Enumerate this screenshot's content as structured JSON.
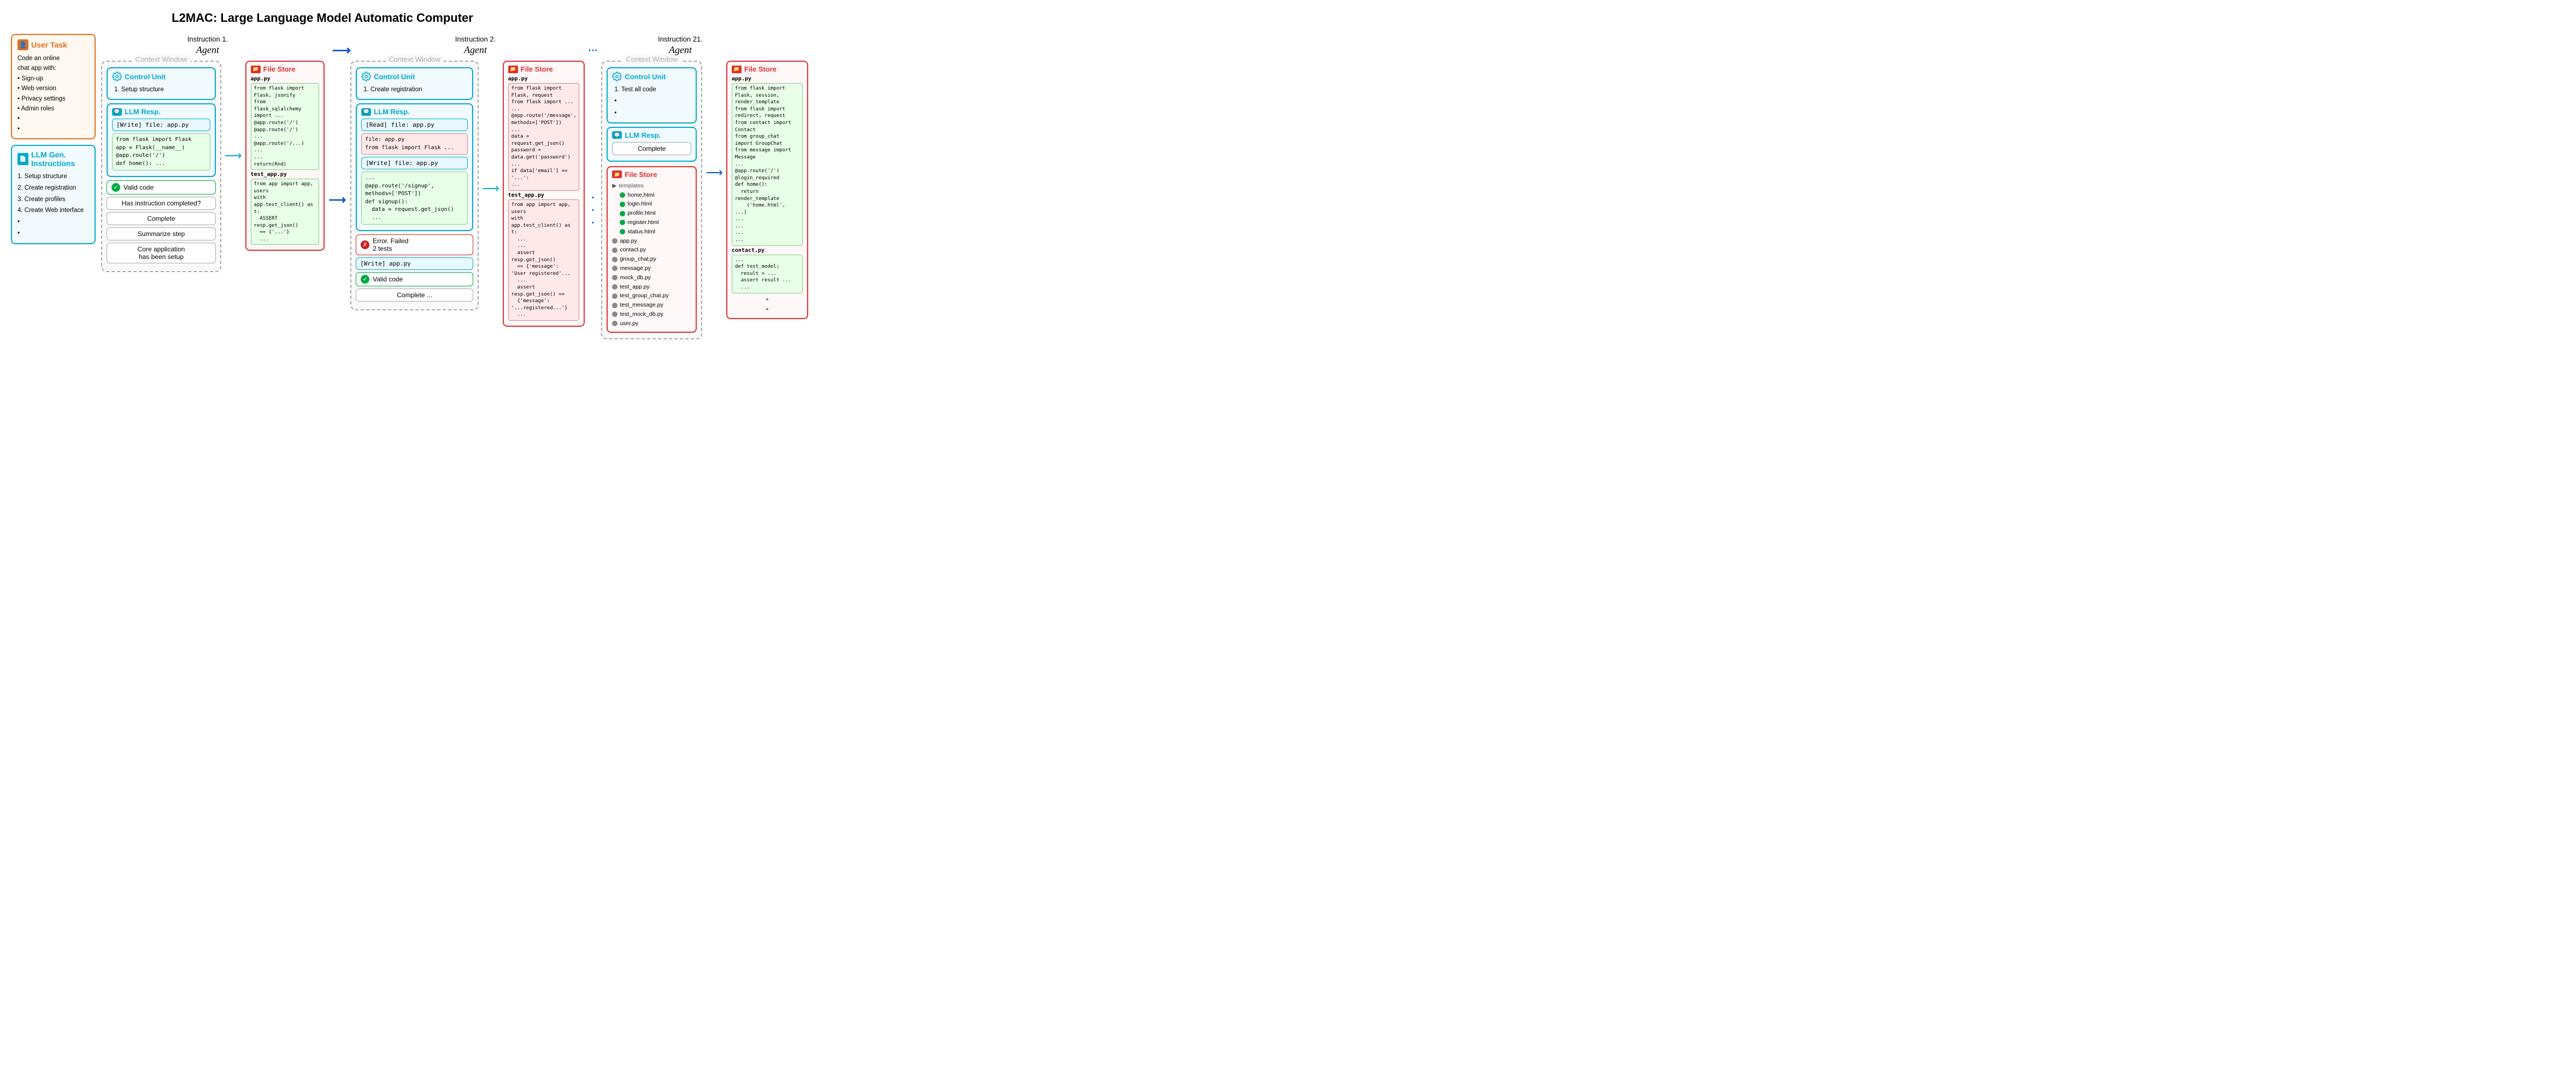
{
  "title": "L2MAC: Large Language Model Automatic Computer",
  "left_panel": {
    "user_task": {
      "header": "User Task",
      "content": "Code an online chat app with:\n• Sign-up\n• Web version\n• Privacy settings\n• Admin roles\n•\n•"
    },
    "llm_gen": {
      "header": "LLM Gen.\nInstructions",
      "items": [
        "1. Setup structure",
        "2. Create registration",
        "3. Create profiles",
        "4. Create Web interface",
        "•",
        "•"
      ]
    }
  },
  "instruction1": {
    "label": "Instruction 1.",
    "agent": "Agent",
    "context_window": "Context Window",
    "control_unit": {
      "header": "Control Unit",
      "instruction": "1. Setup structure"
    },
    "llm_resp": {
      "header": "LLM Resp.",
      "action": "[Write] file: app.py",
      "code": "from flask import Flask\napp = Flask(__name__)\n@app.route('/')\ndef home(): ..."
    },
    "valid_code": "Valid code",
    "question": "Has instruction\ncompleted?",
    "answer": "Complete",
    "summarize": "Summarize step",
    "summary": "Core application\nhas been setup"
  },
  "filestore1": {
    "header": "File Store",
    "app_py_label": "app.py",
    "app_py_code": "from flask import Flask, jsonify\nfrom flask_sqlalchemy import ...\n@app.route('/')\n@app.route('/') \n...\n@app.route('/...') \n...\n...\nreturn(Rnd)",
    "test_app_label": "test_app.py",
    "test_app_code": "from app import app, users\nwith app.test_client() as t:\n    ASSERT resp.get_json() == {'...'}\n    ...",
    "app_py_color": "green",
    "test_app_color": "green"
  },
  "instruction2": {
    "label": "Instruction 2.",
    "agent": "Agent",
    "context_window": "Context Window",
    "control_unit": {
      "header": "Control Unit",
      "instruction": "1. Create registration"
    },
    "llm_resp": {
      "header": "LLM Resp.",
      "action_read": "[Read] file: app.py",
      "file_content": "file: app.py\nfrom flask import Flask ...",
      "action_write": "[Write] file: app.py",
      "code_write": "...\n@app.route('/signup',\nmethods=['POST'])\ndef signup():\n    data = request.get_json()\n    ..."
    },
    "error": "Error. Failed\n2 tests",
    "action_write2": "[Write] app.py",
    "valid_code": "Valid code",
    "answer": "Complete ..."
  },
  "filestore2": {
    "header": "File Store",
    "app_py_label": "app.py",
    "app_py_code": "from flask import Flask, request\nfrom flask import ...\n...\n@app.route('/message', methods=['POST'])\n...\ndata = request.get_json()\npassword = data.get('password')\n...\nif data['email'] == '...':\n...",
    "test_app_label": "test_app.py",
    "test_app_code": "from app import app, users\n    with app.test_client() as t:\n    ...\n    ...\n    assert resp.get_json() == {'message': 'User registered'...\n    ...\n    assert resp.get_json() == {'message': '...registered...'}\n    ..."
  },
  "dots": "· · ·",
  "instruction21": {
    "label": "Instruction 21.",
    "agent": "Agent",
    "context_window": "Context Window",
    "control_unit": {
      "header": "Control Unit",
      "instruction": "1. Test all code"
    },
    "llm_resp": {
      "header": "LLM Resp.",
      "answer": "Complete"
    }
  },
  "filestore3": {
    "header": "File Store",
    "trees": {
      "templates_label": "templates",
      "templates_files": [
        "home.html",
        "login.html",
        "profile.html",
        "register.html",
        "status.html"
      ],
      "py_files": [
        "app.py",
        "contact.py",
        "group_chat.py",
        "message.py",
        "mock_db.py",
        "test_app.py",
        "test_group_chat.py",
        "test_message.py",
        "test_mock_db.py",
        "user.py"
      ]
    }
  },
  "filestore4": {
    "header": "File Store",
    "app_py_label": "app.py",
    "app_py_code": "from flask import Flask, session, render_template\nfrom flask import redirect, request\nfrom contact import Contact\nfrom group_chat import GroupChat\nfrom message import Message\n...\n@app.route('/')\n@login_required\ndef home(): \n    return render_template('home.html', ...)\n...\n...\n...\n...",
    "contact_py_label": "contact.py",
    "contact_py_code": "...\ndef test_model;\n    result = ...\n    assert result ...\n    ..."
  },
  "colors": {
    "accent_blue": "#1155cc",
    "accent_teal": "#00aacc",
    "accent_orange": "#e07020",
    "accent_red": "#e03030",
    "accent_green": "#00aa44",
    "bg_light_blue": "#f0faff",
    "bg_light_orange": "#fff8f0",
    "bg_light_red": "#fff8f8",
    "bg_light_green": "#e8ffe8"
  }
}
